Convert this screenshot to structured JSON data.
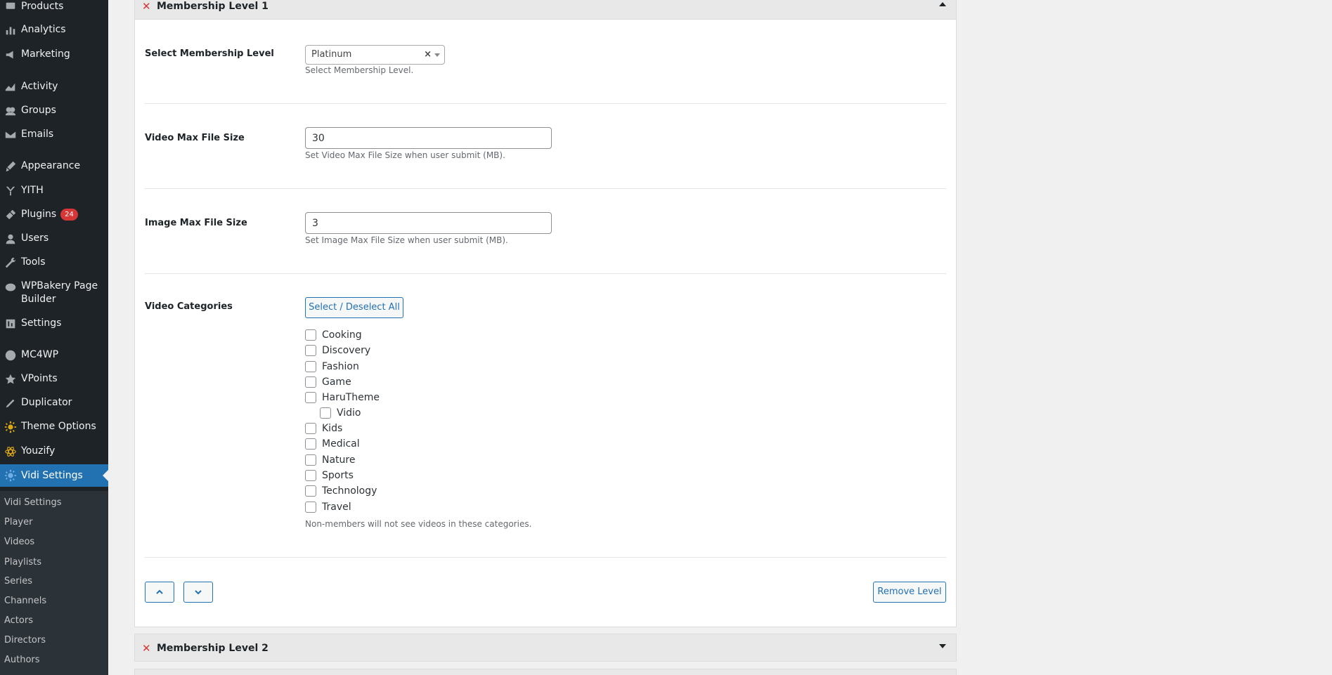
{
  "sidebar": {
    "items": [
      {
        "label": "Products",
        "icon": "products-icon"
      },
      {
        "label": "Analytics",
        "icon": "analytics-icon"
      },
      {
        "label": "Marketing",
        "icon": "marketing-icon"
      },
      {
        "label": "Activity",
        "icon": "activity-icon"
      },
      {
        "label": "Groups",
        "icon": "groups-icon"
      },
      {
        "label": "Emails",
        "icon": "emails-icon"
      },
      {
        "label": "Appearance",
        "icon": "appearance-icon"
      },
      {
        "label": "YITH",
        "icon": "yith-icon"
      },
      {
        "label": "Plugins",
        "icon": "plugins-icon",
        "badge": "24"
      },
      {
        "label": "Users",
        "icon": "users-icon"
      },
      {
        "label": "Tools",
        "icon": "tools-icon"
      },
      {
        "label": "WPBakery Page",
        "label2": "Builder",
        "icon": "wpbakery-icon"
      },
      {
        "label": "Settings",
        "icon": "settings-icon"
      },
      {
        "label": "MC4WP",
        "icon": "mc4wp-icon"
      },
      {
        "label": "VPoints",
        "icon": "star-icon"
      },
      {
        "label": "Duplicator",
        "icon": "duplicator-icon"
      },
      {
        "label": "Theme Options",
        "icon": "gear-icon"
      },
      {
        "label": "Youzify",
        "icon": "atom-icon"
      },
      {
        "label": "Vidi Settings",
        "icon": "gear-icon"
      }
    ],
    "submenu": [
      "Vidi Settings",
      "Player",
      "Videos",
      "Playlists",
      "Series",
      "Channels",
      "Actors",
      "Directors",
      "Authors"
    ]
  },
  "level1": {
    "title": "Membership Level 1",
    "select_label": "Select Membership Level",
    "select_value": "Platinum",
    "select_clear": "×",
    "select_desc": "Select Membership Level.",
    "video_label": "Video Max File Size",
    "video_value": "30",
    "video_desc": "Set Video Max File Size when user submit (MB).",
    "image_label": "Image Max File Size",
    "image_value": "3",
    "image_desc": "Set Image Max File Size when user submit (MB).",
    "cat_label": "Video Categories",
    "select_all": "Select / Deselect All",
    "categories": [
      "Cooking",
      "Discovery",
      "Fashion",
      "Game",
      "HaruTheme",
      "Vidio",
      "Kids",
      "Medical",
      "Nature",
      "Sports",
      "Technology",
      "Travel"
    ],
    "cat_desc": "Non-members will not see videos in these categories.",
    "remove": "Remove Level"
  },
  "level2": {
    "title": "Membership Level 2"
  },
  "colors": {
    "accent": "#2271b1",
    "sidebar_bg": "#1d2327",
    "remove_x": "#d63638"
  }
}
